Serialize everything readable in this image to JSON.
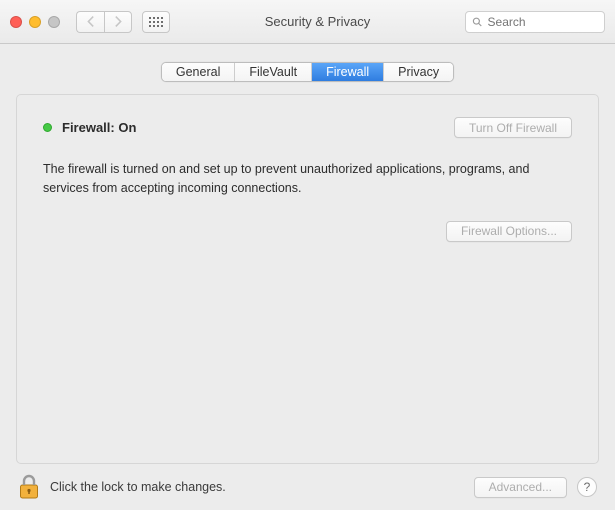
{
  "title": "Security & Privacy",
  "search": {
    "placeholder": "Search"
  },
  "tabs": {
    "t0": "General",
    "t1": "FileVault",
    "t2": "Firewall",
    "t3": "Privacy"
  },
  "panel": {
    "status_label": "Firewall: On",
    "turnoff_label": "Turn Off Firewall",
    "description": "The firewall is turned on and set up to prevent unauthorized applications, programs, and services from accepting incoming connections.",
    "options_label": "Firewall Options..."
  },
  "footer": {
    "lock_text": "Click the lock to make changes.",
    "advanced_label": "Advanced...",
    "help_label": "?"
  }
}
